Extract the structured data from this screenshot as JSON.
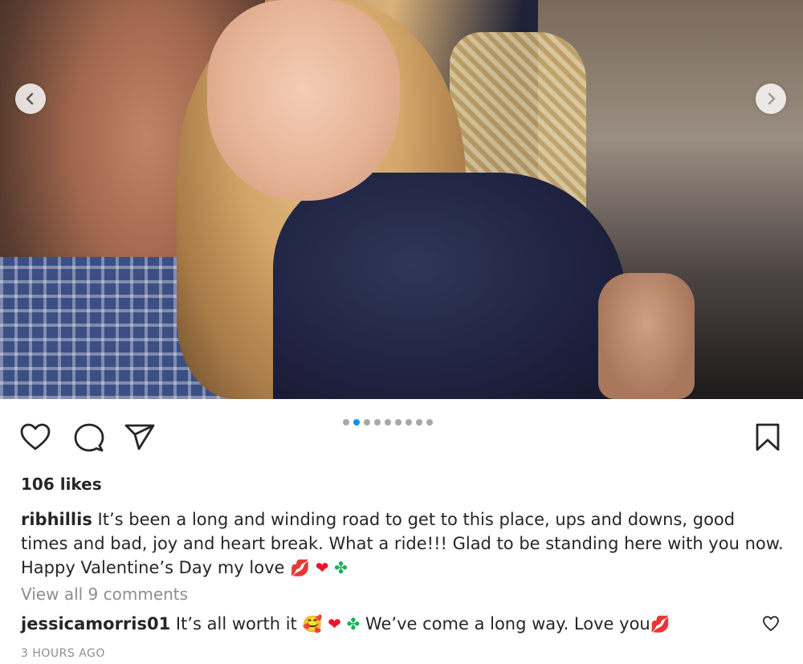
{
  "carousel": {
    "slide_count": 9,
    "active_index": 1,
    "prev_icon": "chevron-left-icon",
    "next_icon": "chevron-right-icon",
    "active_dot_color": "#0095f6",
    "inactive_dot_color": "#a8a8a8"
  },
  "actions": {
    "like_icon": "heart-outline-icon",
    "comment_icon": "speech-bubble-icon",
    "share_icon": "paper-plane-icon",
    "save_icon": "bookmark-icon"
  },
  "post": {
    "likes": "106 likes",
    "caption_user": "ribhillis",
    "caption_text": "It’s been a long and winding road to get to this place, ups and downs, good times and bad, joy and heart break. What a ride!!! Glad to be standing here with you now. Happy Valentine’s Day my love",
    "caption_emojis": [
      "💋",
      "❤",
      "✤"
    ],
    "view_comments": "View all 9 comments",
    "timestamp": "3 HOURS AGO"
  },
  "comment": {
    "user": "jessicamorris01",
    "text_part1": "It’s all worth it",
    "emojis_part1": [
      "🥰",
      "❤",
      "✤"
    ],
    "text_part2": "We’ve come a long way. Love you",
    "emoji_end": "💋"
  }
}
